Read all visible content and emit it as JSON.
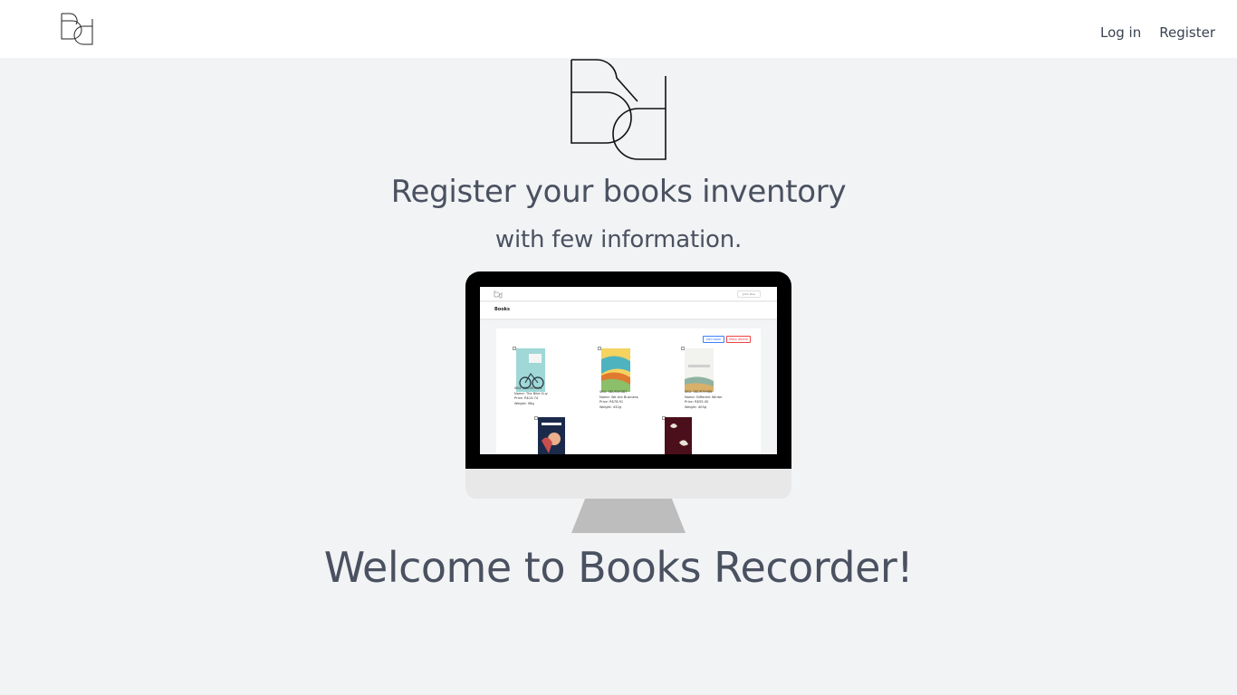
{
  "nav": {
    "login": "Log in",
    "register": "Register"
  },
  "hero": {
    "headline": "Register your books inventory",
    "subheadline": "with few information.",
    "welcome": "Welcome to Books Recorder!"
  },
  "preview": {
    "page_title": "Books",
    "user_menu": "John Doe",
    "add_button": "Add book",
    "delete_button": "Mass delete",
    "books": [
      {
        "sku": "SKU: SKU393474",
        "name": "Name: The Bike Guy",
        "price": "Price: R$14.74",
        "weight": "Weight: 98g"
      },
      {
        "sku": "SKU: SKU939387",
        "name": "Name: We Are Business",
        "price": "Price: R$78.91",
        "weight": "Weight: 432g"
      },
      {
        "sku": "SKU: SKU979986",
        "name": "Name: Different Winter",
        "price": "Price: R$55.45",
        "weight": "Weight: 405g"
      }
    ]
  },
  "colors": {
    "page_bg": "#f2f3f5",
    "topbar_bg": "#ffffff",
    "text": "#4a5160",
    "monitor_frame": "#000000",
    "monitor_chin": "#e8e8e9",
    "monitor_stand": "#bdbdbd"
  }
}
